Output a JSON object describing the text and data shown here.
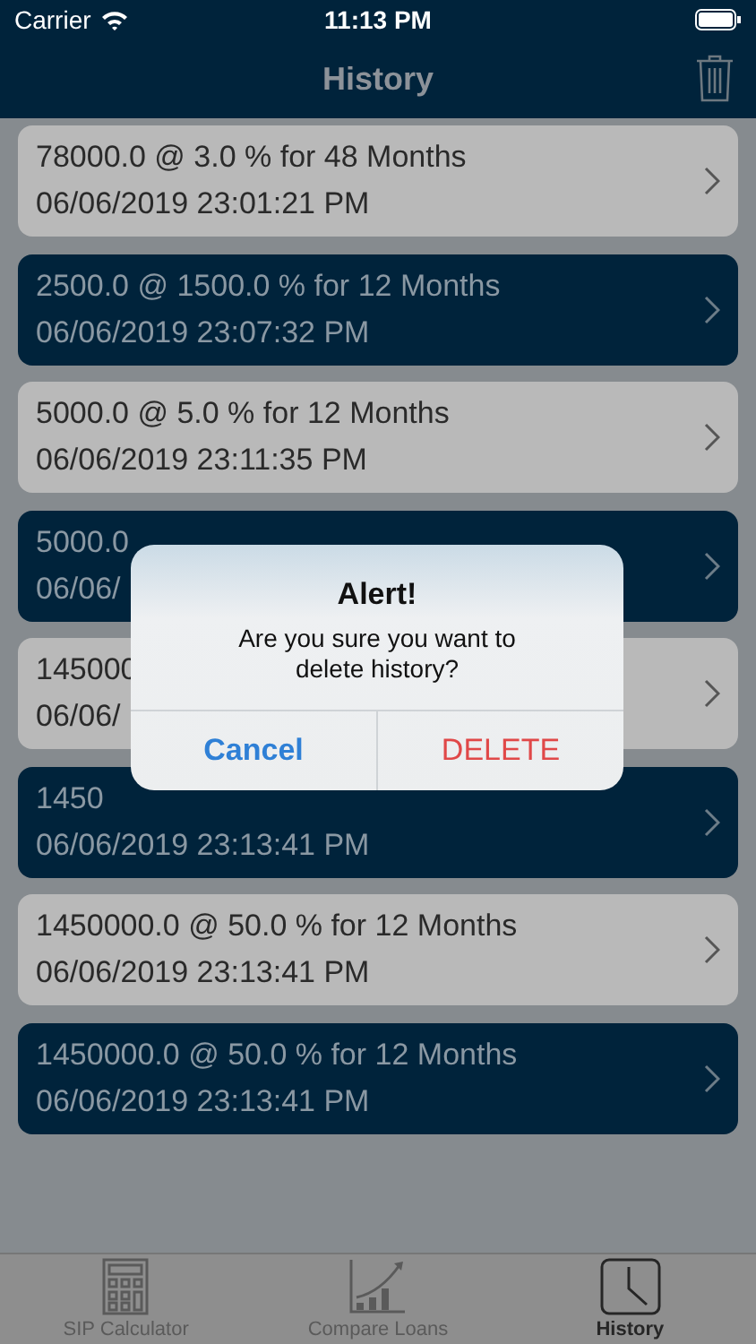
{
  "status_bar": {
    "carrier": "Carrier",
    "time": "11:13 PM"
  },
  "nav_bar": {
    "title": "History"
  },
  "history": [
    {
      "kind": "light",
      "title": "78000.0 @ 3.0 % for 48 Months",
      "date": "06/06/2019 23:01:21 PM"
    },
    {
      "kind": "dark",
      "title": "2500.0 @ 1500.0 % for 12 Months",
      "date": "06/06/2019 23:07:32 PM"
    },
    {
      "kind": "light",
      "title": "5000.0 @ 5.0 % for 12 Months",
      "date": "06/06/2019 23:11:35 PM"
    },
    {
      "kind": "dark",
      "title": "5000.0",
      "date": "06/06/"
    },
    {
      "kind": "light",
      "title": "145000",
      "date": "06/06/"
    },
    {
      "kind": "dark",
      "title": "1450",
      "date": "06/06/2019 23:13:41 PM"
    },
    {
      "kind": "light",
      "title": "1450000.0 @ 50.0 % for 12 Months",
      "date": "06/06/2019 23:13:41 PM"
    },
    {
      "kind": "dark",
      "title": "1450000.0 @ 50.0 % for 12 Months",
      "date": "06/06/2019 23:13:41 PM"
    }
  ],
  "alert": {
    "title": "Alert!",
    "message": "Are you sure you want to delete history?",
    "buttons": [
      {
        "label": "Cancel",
        "kind": "cancel"
      },
      {
        "label": "DELETE",
        "kind": "destructive"
      }
    ]
  },
  "tab_bar": [
    {
      "label": "SIP Calculator",
      "selected": false
    },
    {
      "label": "Compare Loans",
      "selected": false
    },
    {
      "label": "History",
      "selected": true
    }
  ]
}
